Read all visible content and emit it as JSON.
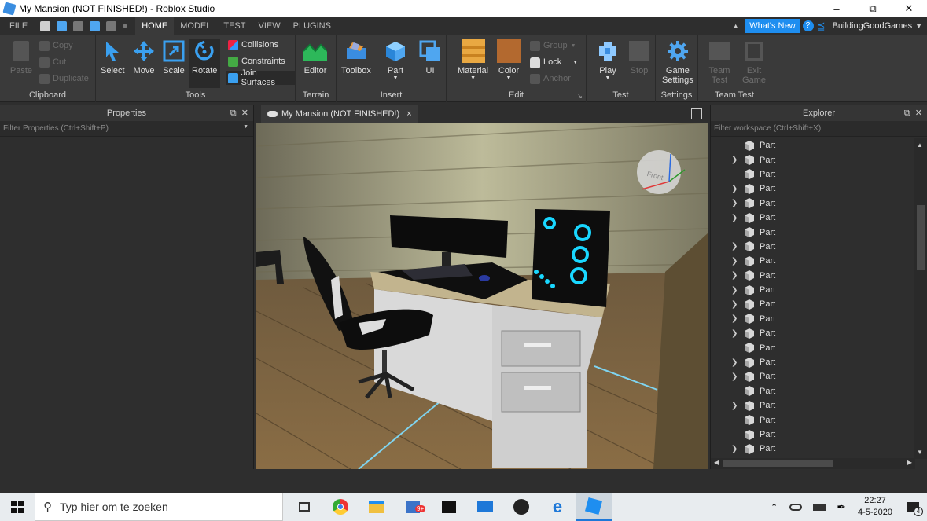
{
  "window": {
    "title": "My Mansion (NOT FINISHED!) - Roblox Studio"
  },
  "menu": {
    "tabs": [
      "FILE",
      "HOME",
      "MODEL",
      "TEST",
      "VIEW",
      "PLUGINS"
    ],
    "whats_new": "What's New",
    "help": "?",
    "username": "BuildingGoodGames"
  },
  "ribbon": {
    "clipboard": {
      "label": "Clipboard",
      "paste": "Paste",
      "copy": "Copy",
      "cut": "Cut",
      "duplicate": "Duplicate"
    },
    "tools": {
      "label": "Tools",
      "select": "Select",
      "move": "Move",
      "scale": "Scale",
      "rotate": "Rotate",
      "collisions": "Collisions",
      "constraints": "Constraints",
      "join_surfaces": "Join Surfaces"
    },
    "terrain": {
      "label": "Terrain",
      "editor": "Editor"
    },
    "insert": {
      "label": "Insert",
      "toolbox": "Toolbox",
      "part": "Part",
      "ui": "UI"
    },
    "edit": {
      "label": "Edit",
      "material": "Material",
      "color": "Color",
      "group": "Group",
      "lock": "Lock",
      "anchor": "Anchor"
    },
    "test": {
      "label": "Test",
      "play": "Play",
      "stop": "Stop"
    },
    "settings": {
      "label": "Settings",
      "game_settings_1": "Game",
      "game_settings_2": "Settings"
    },
    "team_test": {
      "label": "Team Test",
      "team_1": "Team",
      "team_2": "Test",
      "exit_1": "Exit",
      "exit_2": "Game"
    }
  },
  "properties": {
    "title": "Properties",
    "filter_placeholder": "Filter Properties (Ctrl+Shift+P)"
  },
  "viewport": {
    "tab_label": "My Mansion (NOT FINISHED!)",
    "close": "×",
    "gizmo_label": "Front"
  },
  "explorer": {
    "title": "Explorer",
    "filter_placeholder": "Filter workspace (Ctrl+Shift+X)",
    "items": [
      {
        "label": "Part",
        "expandable": false
      },
      {
        "label": "Part",
        "expandable": true
      },
      {
        "label": "Part",
        "expandable": false
      },
      {
        "label": "Part",
        "expandable": true
      },
      {
        "label": "Part",
        "expandable": true
      },
      {
        "label": "Part",
        "expandable": true
      },
      {
        "label": "Part",
        "expandable": false
      },
      {
        "label": "Part",
        "expandable": true
      },
      {
        "label": "Part",
        "expandable": true
      },
      {
        "label": "Part",
        "expandable": true
      },
      {
        "label": "Part",
        "expandable": true
      },
      {
        "label": "Part",
        "expandable": true
      },
      {
        "label": "Part",
        "expandable": true
      },
      {
        "label": "Part",
        "expandable": true
      },
      {
        "label": "Part",
        "expandable": false
      },
      {
        "label": "Part",
        "expandable": true
      },
      {
        "label": "Part",
        "expandable": true
      },
      {
        "label": "Part",
        "expandable": false
      },
      {
        "label": "Part",
        "expandable": true
      },
      {
        "label": "Part",
        "expandable": false
      },
      {
        "label": "Part",
        "expandable": false
      },
      {
        "label": "Part",
        "expandable": true
      }
    ]
  },
  "taskbar": {
    "search_placeholder": "Typ hier om te zoeken",
    "time": "22:27",
    "date": "4-5-2020",
    "notification_count": "4",
    "mail_badge": "9+"
  },
  "colors": {
    "accent": "#1e8ef0",
    "panel": "#2e2e2e",
    "ribbon": "#3a3a3a"
  }
}
